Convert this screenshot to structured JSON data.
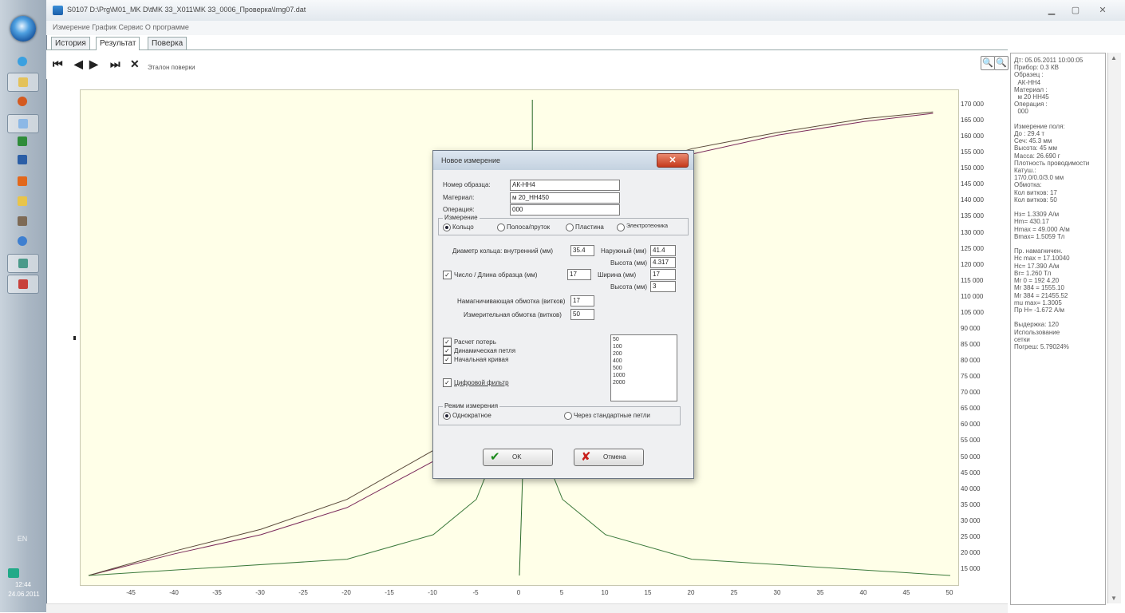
{
  "window": {
    "title": "S0107 D:\\Prg\\M01_MK D\\tMK 33_X011\\MK 33_0006_Проверка\\Img07.dat",
    "menu_text": "Измерение  График  Сервис  О программе"
  },
  "tabs": [
    "История",
    "Результат",
    "Поверка"
  ],
  "toolbar": {
    "first_label": "⏮",
    "prev_label": "◀",
    "next_label": "▶",
    "last_label": "⏭",
    "close_label": "✕",
    "status_text": "Эталон поверки",
    "zoom_in_icon": "🔍",
    "zoom_out_icon": "🔍"
  },
  "info_panel": {
    "text": "Дт: 05.05.2011 10:00:05\nПрибор: 0.3 КВ\nОбразец :\n  АК-НН4\nМатериал :\n  м 20 НН45\nОперация :\n  000\n\nИзмерение поля:\nДо : 29.4 т\nСеч: 45.3 мм\nВысота: 45 мм\nМасса: 26.690 г\nПлотность проводимости\nКатуш.:\n17/0.0/0.0/3.0 мм\nОбмотка:\nКол витков: 17\nКол витков: 50\n\nНз= 1.3309 А/м\nHm= 430.17\nHmax = 49.000 А/м\nBmax= 1.5059 Тл\n\nПр. намагничен.\nHc max = 17.10040\nHc= 17.390 А/м\nBr= 1.260 Тл\nМr 0 = 192 4.20\nМr 384 = 1555.10\nМr 384 = 21455.52\nmu max= 1.3005\nПр Н= -1.672 А/м\n\nВыдержка: 120\nИспользование\nсетки\nПогреш: 5.79024%"
  },
  "chart_data": {
    "type": "line",
    "title": "",
    "xlabel": "",
    "ylabel": "",
    "x_ticks": [
      -45,
      -40,
      -35,
      -30,
      -25,
      -20,
      -15,
      -10,
      -5,
      0,
      5,
      10,
      15,
      20,
      25,
      30,
      35,
      40,
      45,
      50
    ],
    "y_ticks": [
      "170 000",
      "165 000",
      "160 000",
      "155 000",
      "150 000",
      "145 000",
      "140 000",
      "135 000",
      "130 000",
      "125 000",
      "120 000",
      "115 000",
      "110 000",
      "105 000",
      "90 000",
      "85 000",
      "80 000",
      "75 000",
      "70 000",
      "65 000",
      "60 000",
      "55 000",
      "50 000",
      "45 000",
      "40 000",
      "35 000",
      "30 000",
      "25 000",
      "20 000",
      "15 000"
    ],
    "xlim": [
      -50,
      50
    ],
    "grid": false,
    "series": [
      {
        "color": "#7a2a5a",
        "points": [
          [
            -50,
            0
          ],
          [
            -40,
            8000
          ],
          [
            -30,
            15000
          ],
          [
            -20,
            25000
          ],
          [
            -10,
            42000
          ],
          [
            -5,
            58000
          ],
          [
            0,
            75000
          ],
          [
            5,
            120000
          ],
          [
            10,
            140000
          ],
          [
            15,
            150000
          ],
          [
            20,
            155000
          ],
          [
            30,
            162000
          ],
          [
            40,
            167000
          ],
          [
            48,
            170000
          ]
        ]
      },
      {
        "color": "#5a4a3a",
        "points": [
          [
            -50,
            0
          ],
          [
            -40,
            9000
          ],
          [
            -30,
            17000
          ],
          [
            -20,
            28000
          ],
          [
            -10,
            46000
          ],
          [
            -5,
            63000
          ],
          [
            0,
            95000
          ],
          [
            5,
            128000
          ],
          [
            10,
            145000
          ],
          [
            15,
            152000
          ],
          [
            20,
            157000
          ],
          [
            30,
            163000
          ],
          [
            40,
            168000
          ],
          [
            48,
            170500
          ]
        ]
      },
      {
        "color": "#3c7a3c",
        "points": [
          [
            -50,
            0
          ],
          [
            -20,
            6000
          ],
          [
            -10,
            15000
          ],
          [
            -5,
            28000
          ],
          [
            -1,
            60000
          ],
          [
            0,
            85000
          ],
          [
            1,
            60000
          ],
          [
            5,
            28000
          ],
          [
            10,
            15000
          ],
          [
            20,
            6000
          ],
          [
            50,
            0
          ]
        ]
      },
      {
        "color": "#2a6a2a",
        "points": [
          [
            1.5,
            175000
          ],
          [
            1.5,
            150000
          ],
          [
            1.2,
            120000
          ],
          [
            1,
            85000
          ],
          [
            0.5,
            50000
          ],
          [
            0.2,
            20000
          ],
          [
            0,
            0
          ]
        ]
      }
    ]
  },
  "dialog": {
    "title": "Новое измерение",
    "close_label": "✕",
    "fields": [
      {
        "label": "Номер образца:",
        "value": "АК-НН4"
      },
      {
        "label": "Материал:",
        "value": "м 20_НН450"
      },
      {
        "label": "Операция:",
        "value": "000"
      }
    ],
    "group_measure_title": "Измерение",
    "measure_options": [
      "Кольцо",
      "Полоса/пруток",
      "Пластина",
      "Электротехника"
    ],
    "row1": {
      "label": "Диаметр кольца: внутренний (мм)",
      "value": "35.4",
      "label2": "Наружный (мм)",
      "value2": "41.4"
    },
    "row1b": {
      "label": "Высота (мм)",
      "value": "4.317"
    },
    "row2": {
      "label": "Число / Длина образца (мм)",
      "value": "17",
      "label2": "Ширина (мм)",
      "value2": "17"
    },
    "row2b": {
      "label": "Высота (мм)",
      "value": "3"
    },
    "row3": {
      "label": "Намагничивающая обмотка (витков)",
      "value": "17"
    },
    "row4": {
      "label": "Измерительная обмотка (витков)",
      "value": "50"
    },
    "checks": [
      "Расчет потерь",
      "Динамическая петля",
      "Начальная кривая",
      "Цифровой фильтр"
    ],
    "list_items": [
      "50",
      "100",
      "200",
      "400",
      "500",
      "1000",
      "2000"
    ],
    "group_mode_title": "Режим измерения",
    "mode_options": [
      "Однократное",
      "Через стандартные петли"
    ],
    "ok_label": "OK",
    "cancel_label": "Отмена"
  },
  "taskbar": {
    "lang": "EN",
    "time": "12:44",
    "date": "24.06.2011"
  }
}
